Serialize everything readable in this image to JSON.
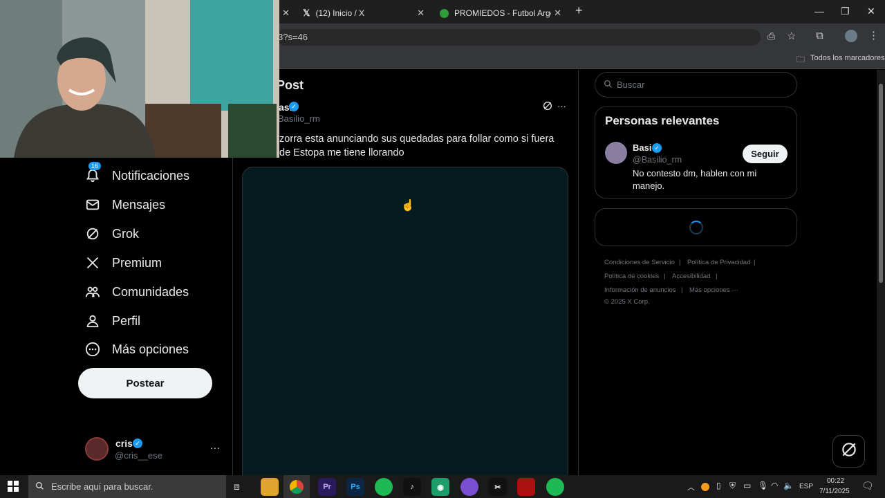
{
  "browser": {
    "tabs": [
      {
        "label": "(12) Inicio / X"
      },
      {
        "label": "PROMIEDOS - Futbol Argentin"
      }
    ],
    "url_fragment": "3?s=46",
    "bookmarks_label": "Todos los marcadores"
  },
  "x_app": {
    "post_header": "Post",
    "author_name": "asi",
    "author_handle": "Basilio_rm",
    "post_text_line1": "zorra esta anunciando sus quedadas para follar como si fuera",
    "post_text_line2": "de Estopa me tiene llorando",
    "notifications_badge": "16",
    "nav": [
      {
        "label": "Notificaciones",
        "icon": "bell-icon"
      },
      {
        "label": "Mensajes",
        "icon": "mail-icon"
      },
      {
        "label": "Grok",
        "icon": "grok-icon"
      },
      {
        "label": "Premium",
        "icon": "x-logo-icon"
      },
      {
        "label": "Comunidades",
        "icon": "people-icon"
      },
      {
        "label": "Perfil",
        "icon": "person-icon"
      },
      {
        "label": "Más opciones",
        "icon": "more-circle-icon"
      }
    ],
    "post_button": "Postear",
    "account": {
      "name": "cris",
      "handle": "@cris__ese"
    },
    "search_placeholder": "Buscar",
    "relevant": {
      "title": "Personas relevantes",
      "name": "Basi",
      "handle": "@Basilio_rm",
      "follow": "Seguir",
      "bio_line1": "No contesto dm, hablen con mi",
      "bio_line2": "manejo."
    },
    "footer": {
      "terms": "Condiciones de Servicio",
      "privacy": "Política de Privacidad",
      "cookies": "Política de cookies",
      "accessibility": "Accesibilidad",
      "ads": "Información de anuncios",
      "more": "Más opciones ···",
      "copyright": "© 2025 X Corp."
    }
  },
  "taskbar": {
    "search_placeholder": "Escribe aquí para buscar.",
    "language": "ESP",
    "time": "00:22",
    "date": "7/11/2025"
  },
  "colors": {
    "accent_blue": "#1d9bf0",
    "background": "#000000",
    "border": "#2f3336"
  }
}
